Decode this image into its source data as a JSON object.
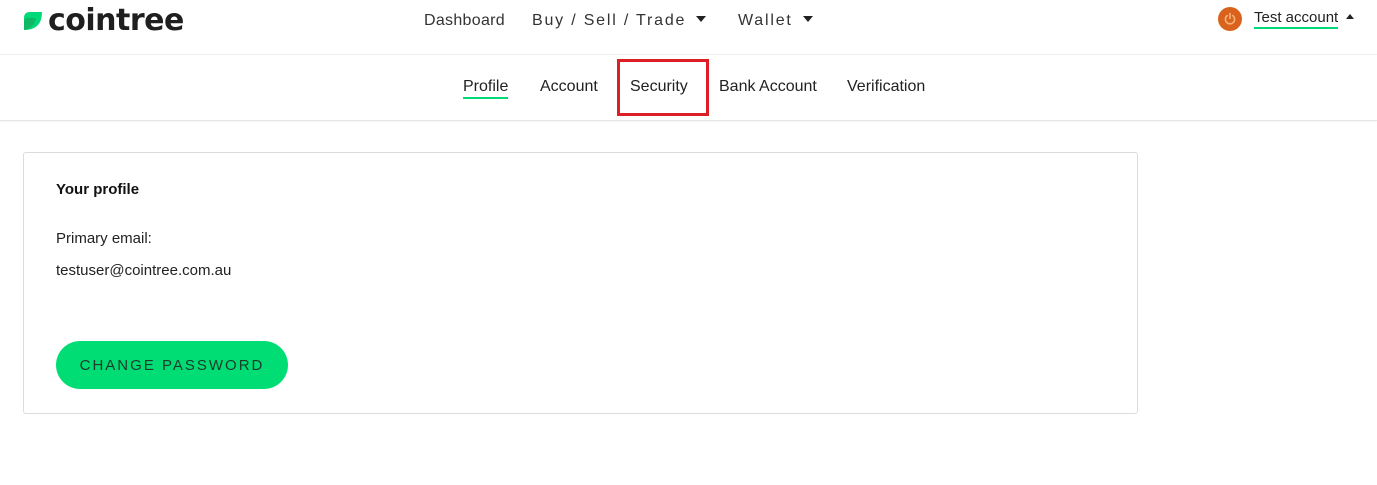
{
  "brand": {
    "name": "cointree",
    "accent_color": "#00d978",
    "mark_icon": "leaf-logo-icon"
  },
  "main_nav": {
    "dashboard": "Dashboard",
    "buy_sell_trade": "Buy / Sell / Trade",
    "wallet": "Wallet"
  },
  "account_menu": {
    "label": "Test account",
    "avatar_icon": "power-icon",
    "avatar_color": "#d9621c"
  },
  "sub_nav": {
    "profile": "Profile",
    "account": "Account",
    "security": "Security",
    "bank_account": "Bank Account",
    "verification": "Verification",
    "active": "Profile",
    "highlighted": "Security",
    "highlight_color": "#dc1f26"
  },
  "profile_card": {
    "title": "Your profile",
    "email_label": "Primary email:",
    "email_value": "testuser@cointree.com.au",
    "change_password_label": "CHANGE PASSWORD",
    "button_color": "#00dd74"
  }
}
